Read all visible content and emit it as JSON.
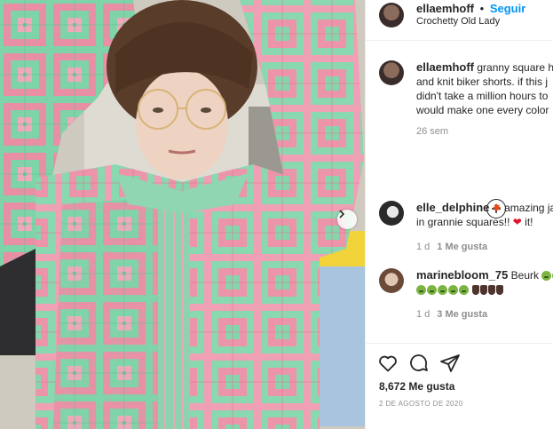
{
  "post": {
    "image_alt": "Crochet granny square jacket"
  },
  "header": {
    "username": "ellaemhoff",
    "separator": "•",
    "follow_label": "Seguir",
    "subtitle": "Crochetty Old Lady"
  },
  "caption": {
    "username": "ellaemhoff",
    "text": "granny square ho and knit biker shorts. if this j didn't take a million hours to would make one every color",
    "time": "26 sem"
  },
  "comments": [
    {
      "username": "elle_delphine",
      "text_a": "amazing ja",
      "text_b": "in grannie squares!!",
      "text_c": "it!",
      "time": "1 d",
      "likes": "1 Me gusta"
    },
    {
      "username": "marinebloom_75",
      "text_a": "Beurk",
      "time": "1 d",
      "likes": "3 Me gusta"
    }
  ],
  "actions": {
    "likes": "8,672 Me gusta",
    "date": "2 DE AGOSTO DE 2020"
  },
  "icons": {
    "next": "chevron-right-icon",
    "load_more": "plus-circle-icon",
    "like": "heart-icon",
    "comment": "comment-icon",
    "share": "share-icon"
  }
}
